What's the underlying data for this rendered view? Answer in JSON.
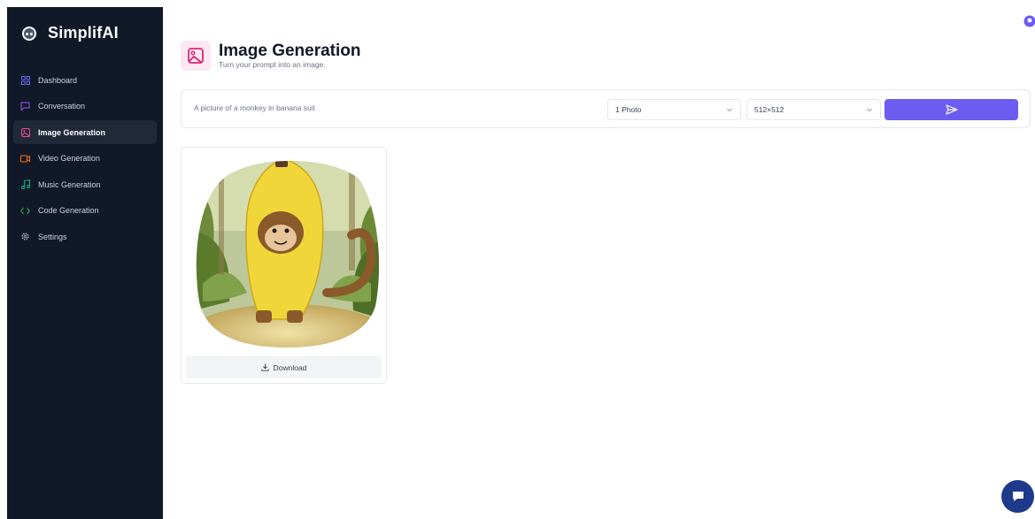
{
  "brand": {
    "name": "SimplifAI"
  },
  "sidebar": {
    "items": [
      {
        "label": "Dashboard",
        "icon": "grid-icon",
        "color": "#6366f1",
        "active": false
      },
      {
        "label": "Conversation",
        "icon": "chat-icon",
        "color": "#8b5cf6",
        "active": false
      },
      {
        "label": "Image Generation",
        "icon": "image-icon",
        "color": "#ec4899",
        "active": true
      },
      {
        "label": "Video Generation",
        "icon": "video-icon",
        "color": "#f97316",
        "active": false
      },
      {
        "label": "Music Generation",
        "icon": "music-icon",
        "color": "#10b981",
        "active": false
      },
      {
        "label": "Code Generation",
        "icon": "code-icon",
        "color": "#22c55e",
        "active": false
      },
      {
        "label": "Settings",
        "icon": "gear-icon",
        "color": "#9ca3af",
        "active": false
      }
    ]
  },
  "header": {
    "title": "Image Generation",
    "subtitle": "Turn your prompt into an image.",
    "icon": "image-icon",
    "icon_color": "#db2777"
  },
  "prompt": {
    "value": "A picture of a monkey in banana suit",
    "amount_selected": "1 Photo",
    "resolution_selected": "512×512",
    "submit_icon": "send-icon",
    "accent": "#6d5cf0"
  },
  "result": {
    "image_subject": "monkey-in-banana-suit",
    "download_label": "Download",
    "download_icon": "download-icon"
  },
  "widgets": {
    "avatar_icon": "user-avatar-icon",
    "chat_icon": "chat-bubble-icon"
  }
}
